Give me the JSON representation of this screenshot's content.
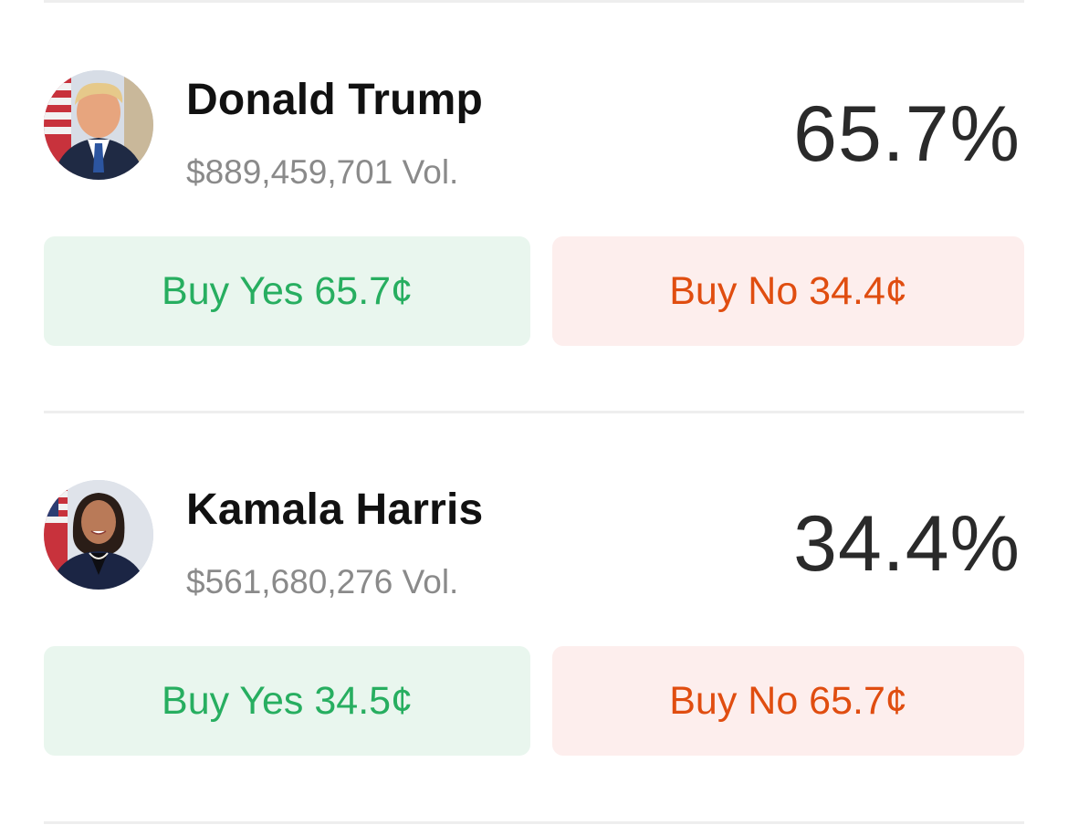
{
  "colors": {
    "yes_text": "#27ae60",
    "yes_bg": "#e9f6ee",
    "no_text": "#e04d10",
    "no_bg": "#fdeeed",
    "divider": "#eeeeee"
  },
  "markets": [
    {
      "avatar_icon": "candidate-portrait-icon",
      "name": "Donald Trump",
      "volume": "$889,459,701 Vol.",
      "probability": "65.7%",
      "buy_yes_label": "Buy Yes 65.7¢",
      "buy_no_label": "Buy No 34.4¢"
    },
    {
      "avatar_icon": "candidate-portrait-icon",
      "name": "Kamala Harris",
      "volume": "$561,680,276 Vol.",
      "probability": "34.4%",
      "buy_yes_label": "Buy Yes 34.5¢",
      "buy_no_label": "Buy No 65.7¢"
    }
  ]
}
